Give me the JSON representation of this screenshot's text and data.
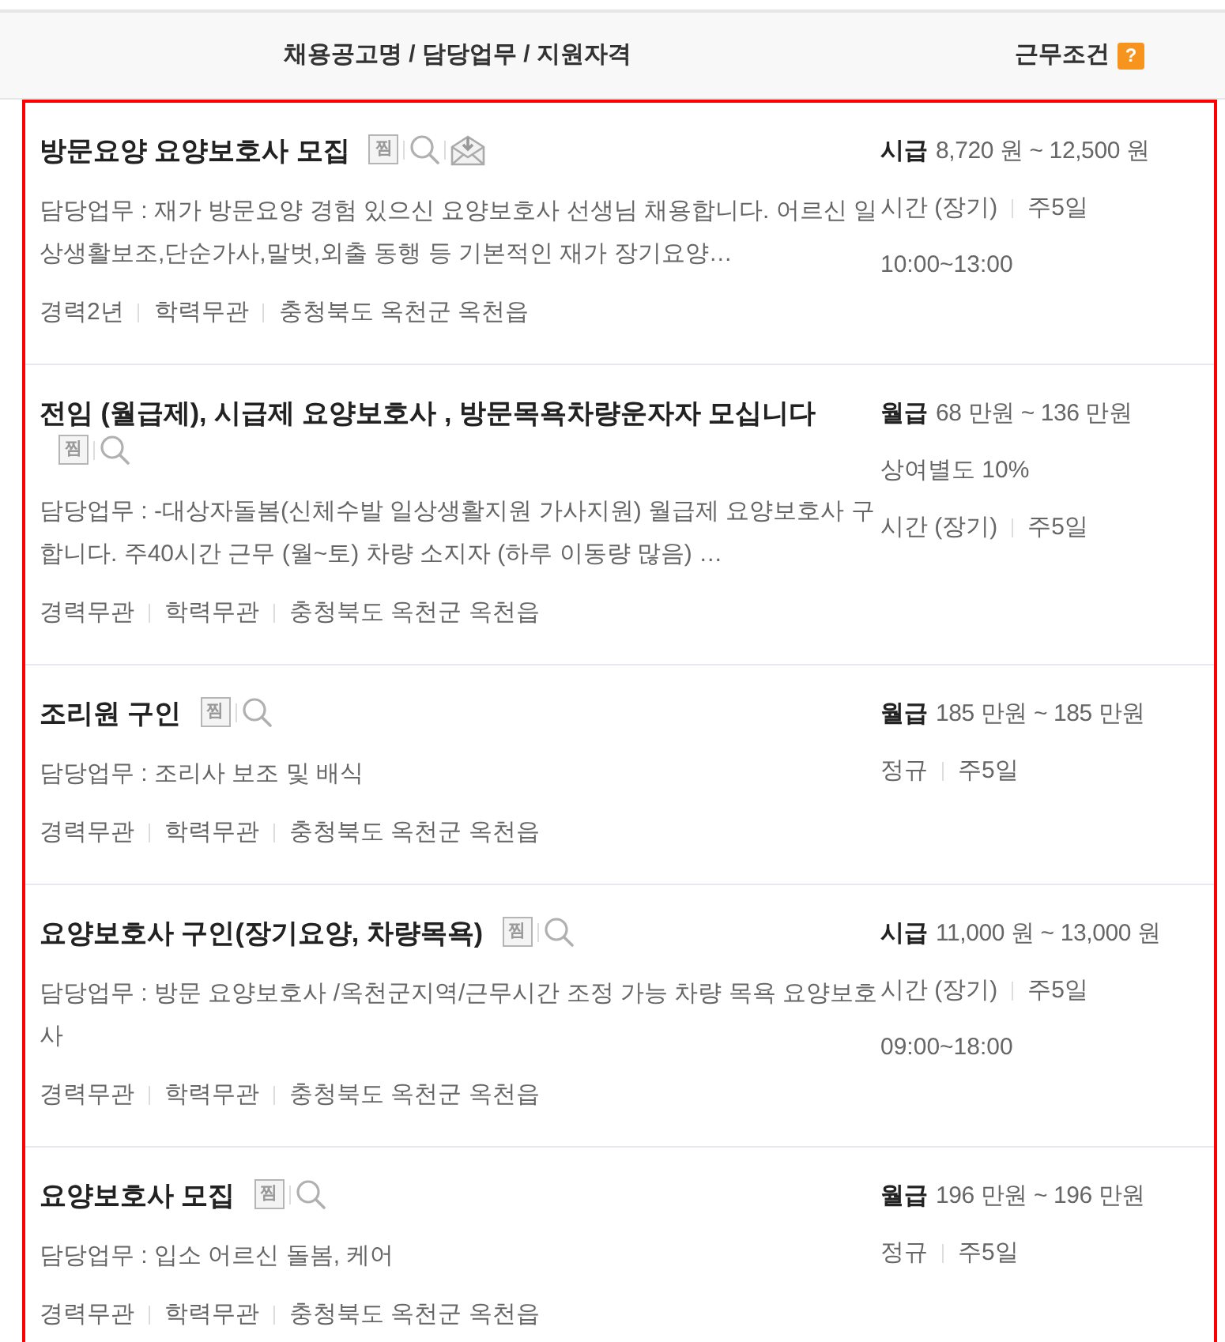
{
  "header": {
    "columns": [
      {
        "label": "채용공고명 / 담당업무 / 지원자격"
      },
      {
        "label": "근무조건",
        "help_badge": "?"
      }
    ]
  },
  "jobs": [
    {
      "title": "방문요양 요양보호사 모집",
      "actions": [
        {
          "kind": "bookmark",
          "label": "찜"
        },
        {
          "kind": "search"
        },
        {
          "kind": "mail"
        }
      ],
      "duty": "담당업무 : 재가 방문요양 경험 있으신 요양보호사 선생님 채용합니다. 어르신 일상생활보조,단순가사,말벗,외출 동행 등 기본적인 재가 장기요양…",
      "qualifications": [
        "경력2년",
        "학력무관",
        "충청북도 옥천군 옥천읍"
      ],
      "pay": {
        "type": "시급",
        "range": "8,720 원 ~ 12,500 원"
      },
      "conditions": [
        [
          "시간 (장기)",
          "주5일"
        ],
        [
          "10:00~13:00"
        ]
      ]
    },
    {
      "title": "전임 (월급제), 시급제 요양보호사 , 방문목욕차량운자자 모십니다",
      "actions": [
        {
          "kind": "bookmark",
          "label": "찜"
        },
        {
          "kind": "search"
        }
      ],
      "duty": "담당업무 : -대상자돌봄(신체수발 일상생활지원 가사지원) 월급제 요양보호사 구합니다. 주40시간 근무 (월~토) 차량 소지자 (하루 이동량 많음) …",
      "qualifications": [
        "경력무관",
        "학력무관",
        "충청북도 옥천군 옥천읍"
      ],
      "pay": {
        "type": "월급",
        "range": "68 만원 ~ 136 만원"
      },
      "conditions": [
        [
          "상여별도 10%"
        ],
        [
          "시간 (장기)",
          "주5일"
        ]
      ]
    },
    {
      "title": "조리원 구인",
      "actions": [
        {
          "kind": "bookmark",
          "label": "찜"
        },
        {
          "kind": "search"
        }
      ],
      "duty": "담당업무 : 조리사 보조 및 배식",
      "qualifications": [
        "경력무관",
        "학력무관",
        "충청북도 옥천군 옥천읍"
      ],
      "pay": {
        "type": "월급",
        "range": "185 만원 ~ 185 만원"
      },
      "conditions": [
        [
          "정규",
          "주5일"
        ]
      ]
    },
    {
      "title": "요양보호사 구인(장기요양, 차량목욕)",
      "actions": [
        {
          "kind": "bookmark",
          "label": "찜"
        },
        {
          "kind": "search"
        }
      ],
      "duty": "담당업무 : 방문 요양보호사 /옥천군지역/근무시간 조정 가능 차량 목욕 요양보호사",
      "qualifications": [
        "경력무관",
        "학력무관",
        "충청북도 옥천군 옥천읍"
      ],
      "pay": {
        "type": "시급",
        "range": "11,000 원 ~ 13,000 원"
      },
      "conditions": [
        [
          "시간 (장기)",
          "주5일"
        ],
        [
          "09:00~18:00"
        ]
      ]
    },
    {
      "title": "요양보호사 모집",
      "actions": [
        {
          "kind": "bookmark",
          "label": "찜"
        },
        {
          "kind": "search"
        }
      ],
      "duty": "담당업무 : 입소 어르신 돌봄, 케어",
      "qualifications": [
        "경력무관",
        "학력무관",
        "충청북도 옥천군 옥천읍"
      ],
      "pay": {
        "type": "월급",
        "range": "196 만원 ~ 196 만원"
      },
      "conditions": [
        [
          "정규",
          "주5일"
        ]
      ]
    }
  ]
}
